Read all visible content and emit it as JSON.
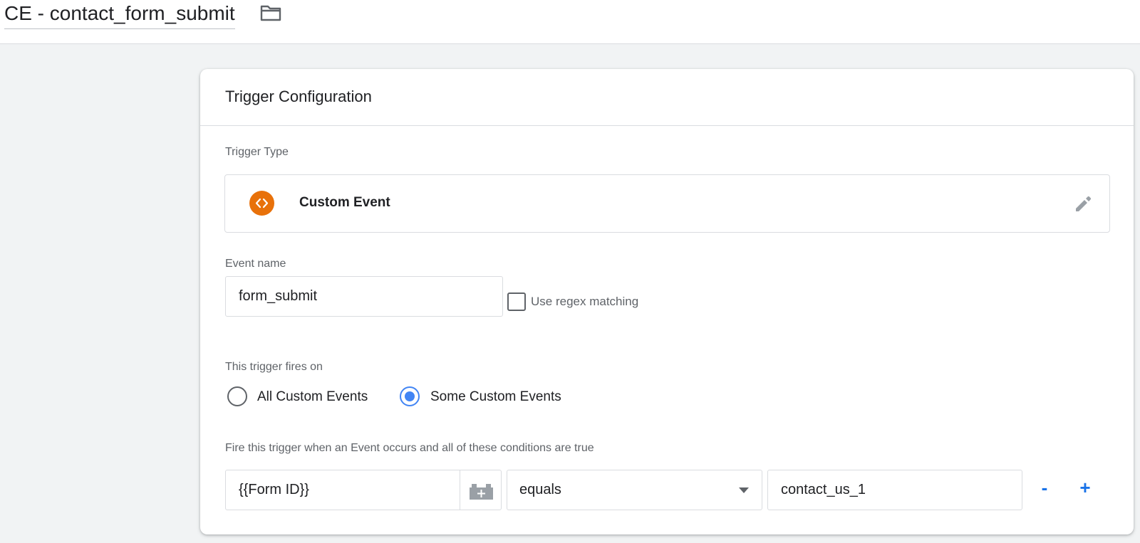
{
  "header": {
    "title": "CE - contact_form_submit",
    "folder_icon": "folder-icon"
  },
  "card": {
    "title": "Trigger Configuration",
    "trigger_type": {
      "label": "Trigger Type",
      "name": "Custom Event",
      "icon": "custom-event-code-icon",
      "icon_color": "#e8710a",
      "edit_icon": "pencil-icon"
    },
    "event_name": {
      "label": "Event name",
      "value": "form_submit",
      "regex_label": "Use regex matching",
      "regex_checked": false
    },
    "fires_on": {
      "label": "This trigger fires on",
      "options": [
        {
          "label": "All Custom Events",
          "selected": false
        },
        {
          "label": "Some Custom Events",
          "selected": true
        }
      ],
      "accent": "#4285f4"
    },
    "conditions": {
      "label": "Fire this trigger when an Event occurs and all of these conditions are true",
      "variable": "{{Form ID}}",
      "variable_icon": "variable-block-icon",
      "operator": "equals",
      "value": "contact_us_1",
      "remove_label": "-",
      "add_label": "+",
      "link_color": "#1a73e8"
    }
  }
}
